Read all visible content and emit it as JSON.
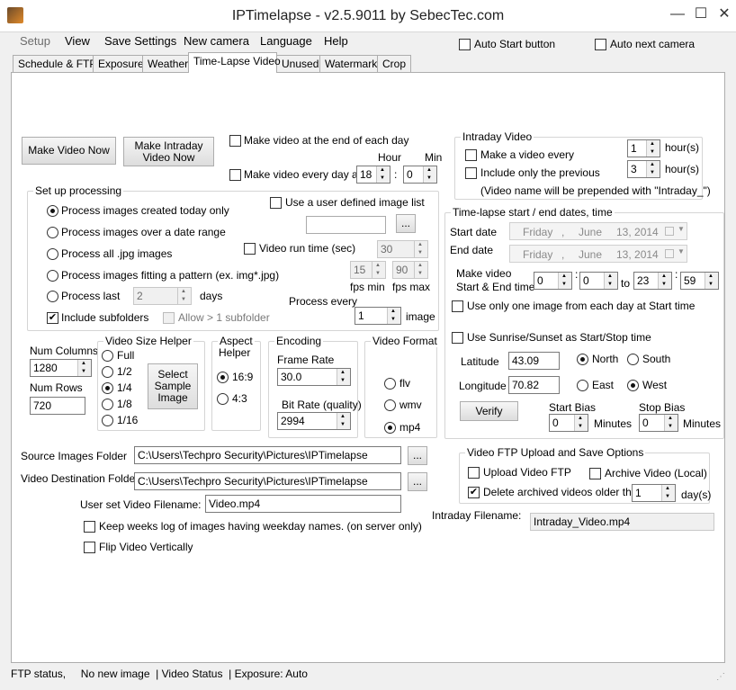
{
  "window": {
    "title": "IPTimelapse - v2.5.9011 by SebecTec.com",
    "minimize": "—",
    "maximize": "☐",
    "close": "✕"
  },
  "menu": {
    "items": [
      "Setup",
      "View",
      "Save Settings",
      "New camera",
      "Language",
      "Help"
    ]
  },
  "toolbar": {
    "auto_start": "Auto Start button",
    "auto_next": "Auto next camera"
  },
  "tabs": [
    "Schedule & FTP",
    "Exposure",
    "Weather",
    "Time-Lapse Video",
    "Unused",
    "Watermark",
    "Crop"
  ],
  "buttons": {
    "make_video_now": "Make Video Now",
    "make_intraday_1": "Make Intraday",
    "make_intraday_2": "Video Now",
    "browse": "...",
    "verify": "Verify",
    "select_sample_1": "Select",
    "select_sample_2": "Sample",
    "select_sample_3": "Image"
  },
  "make_video": {
    "end_of_day": "Make video at the end of each day",
    "every_day_at": "Make video every day at",
    "hour_label": "Hour",
    "min_label": "Min",
    "hour": "18",
    "min": "0",
    "colon": ":"
  },
  "processing": {
    "title": "Set up processing",
    "today": "Process images created today only",
    "date_range": "Process images over a date range",
    "all_jpg": "Process all .jpg images",
    "pattern": "Process images fitting a pattern (ex. img*.jpg)",
    "last": "Process last",
    "last_value": "2",
    "days": "days",
    "include_sub": "Include subfolders",
    "allow_sub": "Allow > 1 subfolder",
    "user_list": "Use a user defined image list",
    "run_time": "Video run time (sec)",
    "run_time_value": "30",
    "fps_min_value": "15",
    "fps_max_value": "90",
    "fps_min": "fps min",
    "fps_max": "fps max",
    "process_every": "Process every",
    "process_every_value": "1",
    "image": "image"
  },
  "intraday": {
    "title": "Intraday Video",
    "make_every": "Make a video every",
    "make_every_value": "1",
    "hours1": "hour(s)",
    "include_prev": "Include only the previous",
    "include_prev_value": "3",
    "hours2": "hour(s)",
    "note": "(Video name will be prepended with \"Intraday_\")"
  },
  "dates": {
    "title": "Time-lapse start / end dates, time",
    "start_label": "Start date",
    "end_label": "End date",
    "start_day": "Friday",
    "start_month": "June",
    "start_date": "13, 2014",
    "end_day": "Friday",
    "end_month": "June",
    "end_date": "13, 2014",
    "comma": ",",
    "make_video_1": "Make video",
    "make_video_2": "Start & End time",
    "start_h": "0",
    "start_m": "0",
    "to": "to",
    "end_h": "23",
    "end_m": "59",
    "one_image": "Use only one image from each day at Start time",
    "sunrise": "Use Sunrise/Sunset as Start/Stop time",
    "latitude_label": "Latitude",
    "latitude": "43.09",
    "north": "North",
    "south": "South",
    "longitude_label": "Longitude",
    "longitude": "70.82",
    "east": "East",
    "west": "West",
    "start_bias": "Start Bias",
    "start_bias_value": "0",
    "stop_bias": "Stop Bias",
    "stop_bias_value": "0",
    "minutes": "Minutes"
  },
  "size": {
    "num_columns": "Num Columns",
    "columns": "1280",
    "num_rows": "Num Rows",
    "rows": "720"
  },
  "video_size": {
    "title": "Video Size Helper",
    "full": "Full",
    "half": "1/2",
    "quarter": "1/4",
    "eighth": "1/8",
    "sixteenth": "1/16"
  },
  "aspect": {
    "title_1": "Aspect",
    "title_2": "Helper",
    "r169": "16:9",
    "r43": "4:3"
  },
  "encoding": {
    "title": "Encoding",
    "frame_rate": "Frame Rate",
    "frame_rate_value": "30.0",
    "bit_rate": "Bit Rate (quality)",
    "bit_rate_value": "2994"
  },
  "format": {
    "title": "Video Format",
    "flv": "flv",
    "wmv": "wmv",
    "mp4": "mp4"
  },
  "folders": {
    "source_label": "Source Images Folder",
    "source": "C:\\Users\\Techpro Security\\Pictures\\IPTimelapse",
    "dest_label": "Video Destination Folder",
    "dest": "C:\\Users\\Techpro Security\\Pictures\\IPTimelapse",
    "filename_label": "User set Video Filename:",
    "filename": "Video.mp4"
  },
  "options": {
    "weeks_log": "Keep weeks log of images having weekday names. (on server only)",
    "flip": "Flip Video Vertically"
  },
  "ftp": {
    "title": "Video FTP Upload and Save Options",
    "upload": "Upload Video FTP",
    "archive": "Archive Video (Local)",
    "delete": "Delete archived videos older than",
    "delete_value": "1",
    "days": "day(s)"
  },
  "intraday_file": {
    "label": "Intraday Filename:",
    "value": "Intraday_Video.mp4"
  },
  "status": {
    "text": "FTP status,     No new image  | Video Status  | Exposure: Auto"
  },
  "colors": {
    "accent": "#0078d7",
    "panel": "#ffffff",
    "chrome": "#f0f0f0"
  }
}
